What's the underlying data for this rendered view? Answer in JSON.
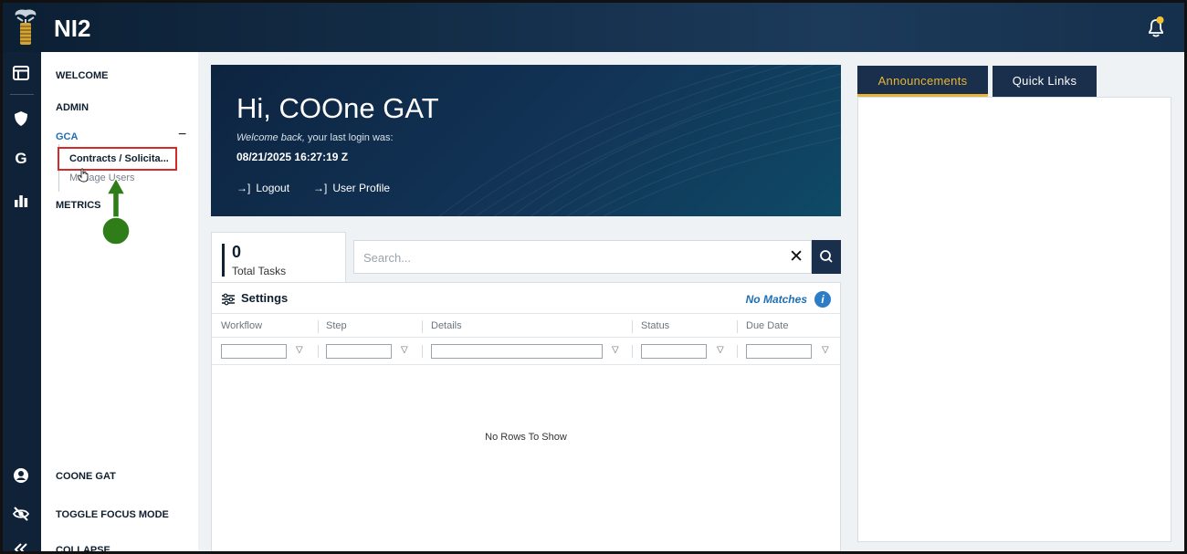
{
  "app": {
    "title": "NI2"
  },
  "rail": {
    "icons": [
      "layout-icon",
      "shield-icon",
      "g-icon",
      "bar-chart-icon",
      "user-circle-icon",
      "eye-slash-icon",
      "double-chevron-left-icon"
    ],
    "g_label": "G"
  },
  "nav": {
    "welcome": "WELCOME",
    "admin": "ADMIN",
    "gca": "GCA",
    "gca_toggle": "−",
    "contracts": "Contracts / Solicita...",
    "manage_users": "Manage Users",
    "metrics": "METRICS",
    "user": "COONE GAT",
    "focus": "TOGGLE FOCUS MODE",
    "collapse": "COLLAPSE"
  },
  "hero": {
    "greeting": "Hi, COOne GAT",
    "welcome_back": "Welcome back,",
    "last_login_text": " your last login was:",
    "last_login": "08/21/2025 16:27:19 Z",
    "logout": "Logout",
    "profile": "User Profile",
    "link_arrow": "→]"
  },
  "tasks": {
    "count": "0",
    "label": "Total Tasks",
    "search_placeholder": "Search...",
    "clear": "✕"
  },
  "grid": {
    "settings": "Settings",
    "no_matches": "No Matches",
    "info": "i",
    "columns": [
      "Workflow",
      "Step",
      "Details",
      "Status",
      "Due Date"
    ],
    "filter_icon": "▽",
    "empty": "No Rows To Show"
  },
  "right": {
    "tabs": [
      "Announcements",
      "Quick Links"
    ]
  },
  "colors": {
    "navy": "#0f2237",
    "accent": "#e8b637",
    "link": "#1f6fb5",
    "highlight": "#d42a2a",
    "annotation": "#2e7d18"
  }
}
